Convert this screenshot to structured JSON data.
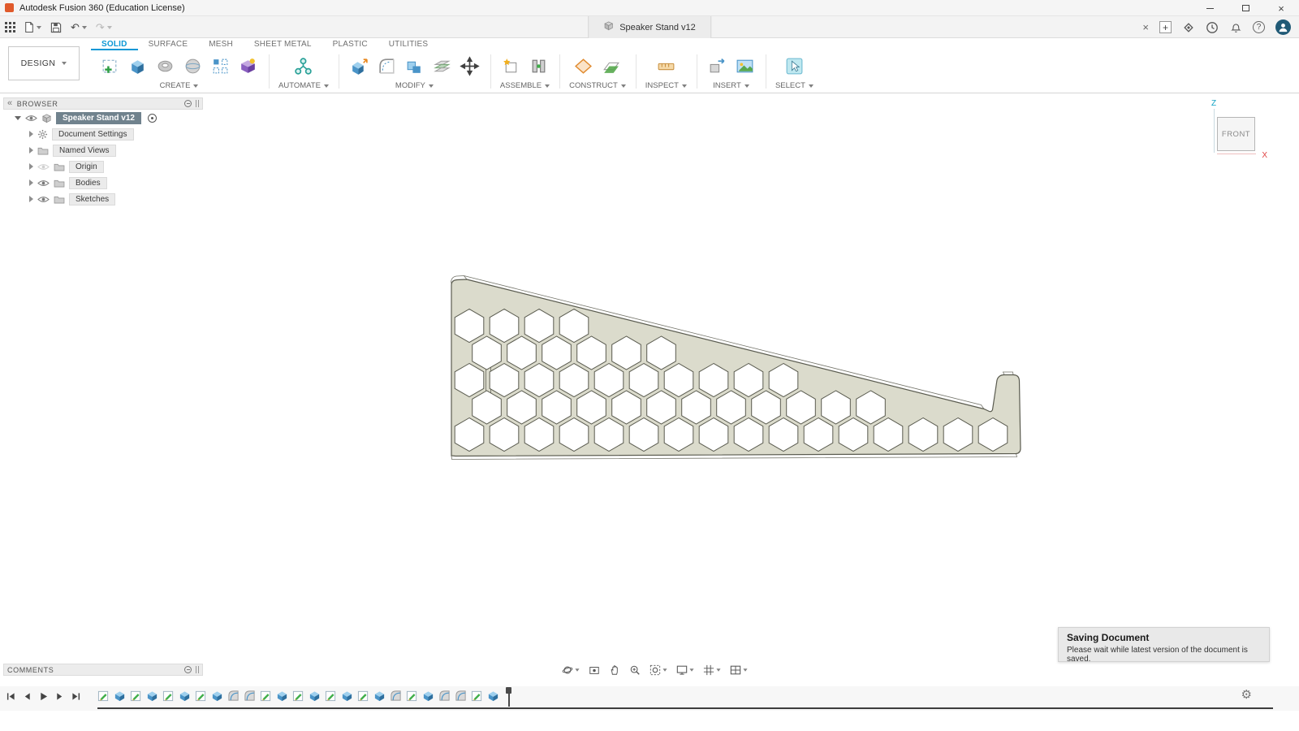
{
  "colors": {
    "accent": "#0a97d5",
    "model_fill": "#dbdbcc",
    "model_edge": "#5a5b4f",
    "selection": "#70828d"
  },
  "icons": {
    "close": "×",
    "plus": "+",
    "undo": "↶",
    "redo": "↷",
    "help": "?",
    "gear": "⚙",
    "collapse": "«"
  },
  "titlebar": {
    "app_title": "Autodesk Fusion 360 (Education License)"
  },
  "tabbar": {
    "document_title": "Speaker Stand v12"
  },
  "ribbon": {
    "design": "DESIGN",
    "tabs": [
      "SOLID",
      "SURFACE",
      "MESH",
      "SHEET METAL",
      "PLASTIC",
      "UTILITIES"
    ],
    "groups": {
      "create": "CREATE",
      "automate": "AUTOMATE",
      "modify": "MODIFY",
      "assemble": "ASSEMBLE",
      "construct": "CONSTRUCT",
      "inspect": "INSPECT",
      "insert": "INSERT",
      "select": "SELECT"
    }
  },
  "browser": {
    "header": "BROWSER",
    "root_label": "Speaker Stand v12",
    "items": [
      {
        "label": "Document Settings"
      },
      {
        "label": "Named Views"
      },
      {
        "label": "Origin"
      },
      {
        "label": "Bodies"
      },
      {
        "label": "Sketches"
      }
    ]
  },
  "viewcube": {
    "face": "FRONT",
    "z_axis": "Z",
    "x_axis": "X"
  },
  "notification": {
    "title": "Saving Document",
    "message": "Please wait while latest version of the document is saved."
  },
  "comments": {
    "header": "COMMENTS"
  },
  "timeline": {
    "features": [
      "sketch",
      "extrude",
      "sketch",
      "extrude",
      "sketch",
      "extrude",
      "sketch",
      "extrude",
      "fillet",
      "fillet",
      "sketch",
      "extrude",
      "sketch",
      "extrude",
      "sketch",
      "extrude",
      "sketch",
      "extrude",
      "fillet",
      "sketch",
      "extrude",
      "fillet",
      "fillet",
      "sketch",
      "extrude"
    ]
  }
}
